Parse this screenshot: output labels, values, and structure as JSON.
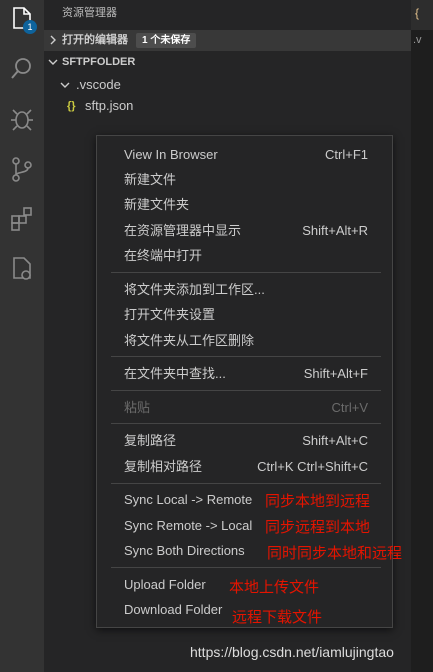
{
  "sidebar": {
    "title": "资源管理器",
    "open_editors": {
      "label": "打开的编辑器",
      "badge": "1 个未保存"
    },
    "folder": {
      "label": "SFTPFOLDER"
    },
    "tree": [
      {
        "label": ".vscode"
      },
      {
        "label": "sftp.json",
        "icon": "{}"
      }
    ]
  },
  "activity": {
    "badge_count": "1"
  },
  "editor": {
    "tab_text": "{",
    "crumb_text": ".v"
  },
  "menu": {
    "items": [
      {
        "label": "View In Browser",
        "key": "Ctrl+F1"
      },
      {
        "label": "新建文件",
        "key": ""
      },
      {
        "label": "新建文件夹",
        "key": ""
      },
      {
        "label": "在资源管理器中显示",
        "key": "Shift+Alt+R"
      },
      {
        "label": "在终端中打开",
        "key": ""
      },
      {
        "label": "将文件夹添加到工作区...",
        "key": ""
      },
      {
        "label": "打开文件夹设置",
        "key": ""
      },
      {
        "label": "将文件夹从工作区删除",
        "key": ""
      },
      {
        "label": "在文件夹中查找...",
        "key": "Shift+Alt+F"
      },
      {
        "label": "粘贴",
        "key": "Ctrl+V"
      },
      {
        "label": "复制路径",
        "key": "Shift+Alt+C"
      },
      {
        "label": "复制相对路径",
        "key": "Ctrl+K Ctrl+Shift+C"
      },
      {
        "label": "Sync Local -> Remote",
        "key": ""
      },
      {
        "label": "Sync Remote -> Local",
        "key": ""
      },
      {
        "label": "Sync Both Directions",
        "key": ""
      },
      {
        "label": "Upload Folder",
        "key": ""
      },
      {
        "label": "Download Folder",
        "key": ""
      }
    ]
  },
  "annotations": {
    "sync_local_remote": "同步本地到远程",
    "sync_remote_local": "同步远程到本地",
    "sync_both": "同时同步本地和远程",
    "upload": "本地上传文件",
    "download": "远程下载文件"
  },
  "watermark": "https://blog.csdn.net/iamlujingtao",
  "colors": {
    "annotation": "#e51400",
    "badge": "#0e639c",
    "json_icon": "#cbcb41"
  }
}
